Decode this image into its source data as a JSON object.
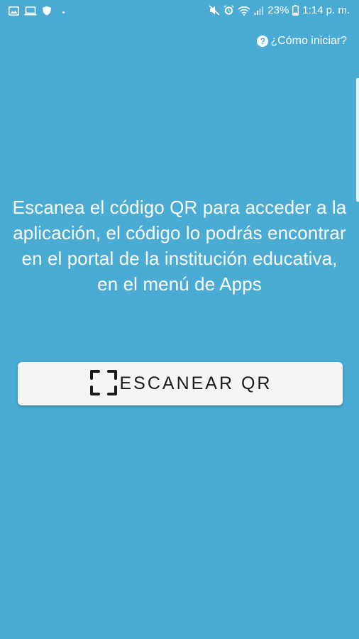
{
  "status_bar": {
    "left_icons": [
      "image-icon",
      "laptop-icon",
      "shield-icon"
    ],
    "battery_percent": "23%",
    "time": "1:14 p. m."
  },
  "header": {
    "help_icon_glyph": "?",
    "help_label": "¿Cómo iniciar?"
  },
  "main": {
    "instruction": "Escanea el código QR para acceder a la aplicación, el código lo podrás encontrar en el portal de la institución educativa, en el menú de Apps",
    "scan_button_label": "ESCANEAR QR",
    "scan_icon": "qr-scan-icon"
  },
  "colors": {
    "background": "#4aacd5",
    "button_bg": "#f5f5f6",
    "text": "#ffffff",
    "button_text": "#1a1a1a"
  }
}
